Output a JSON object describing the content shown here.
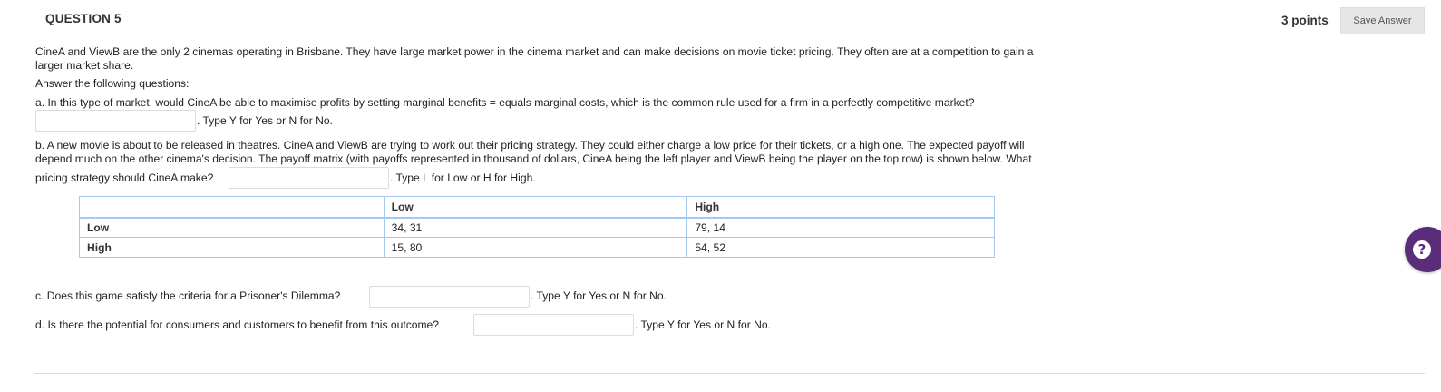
{
  "question": {
    "header": "QUESTION 5",
    "points": "3 points",
    "save_label": "Save Answer"
  },
  "intro": {
    "line1": "CineA and ViewB are the only 2 cinemas operating in Brisbane. They have large market power in the cinema market and can make decisions on movie ticket pricing. They often are at a competition to gain a",
    "line2": "larger market share.",
    "prompt": "Answer the following questions:"
  },
  "part_a": {
    "question": "a. In this type of market, would CineA be able to maximise profits by setting marginal benefits = equals marginal costs, which is the common rule used for a firm in a perfectly competitive market?",
    "answer_value": "",
    "hint": ". Type Y for Yes or N for No."
  },
  "part_b": {
    "line1": "b. A new movie is about to be released in theatres. CineA and ViewB are trying to work out their pricing strategy. They could either charge a low price for their tickets, or a high one. The expected payoff will",
    "line2": "depend much on the other cinema's decision. The payoff matrix (with payoffs represented in thousand of dollars, CineA being the left player and ViewB being the player on the top row) is shown below. What",
    "line3": "pricing strategy should CineA make?",
    "answer_value": "",
    "hint": ". Type L for Low or H for High."
  },
  "payoff_table": {
    "headers": [
      "",
      "Low",
      "High"
    ],
    "rows": [
      {
        "label": "Low",
        "cells": [
          "34, 31",
          "79, 14"
        ]
      },
      {
        "label": "High",
        "cells": [
          "15, 80",
          "54, 52"
        ]
      }
    ]
  },
  "part_c": {
    "question": "c. Does this game satisfy the criteria for a Prisoner's Dilemma?",
    "answer_value": "",
    "hint": ". Type Y for Yes or N for No."
  },
  "part_d": {
    "question": "d. Is there the potential for consumers and customers to benefit from this outcome?",
    "answer_value": "",
    "hint": ". Type Y for Yes or N for No."
  },
  "help": {
    "icon": "question-mark-icon",
    "glyph": "?",
    "color": "#5b2c7a"
  }
}
